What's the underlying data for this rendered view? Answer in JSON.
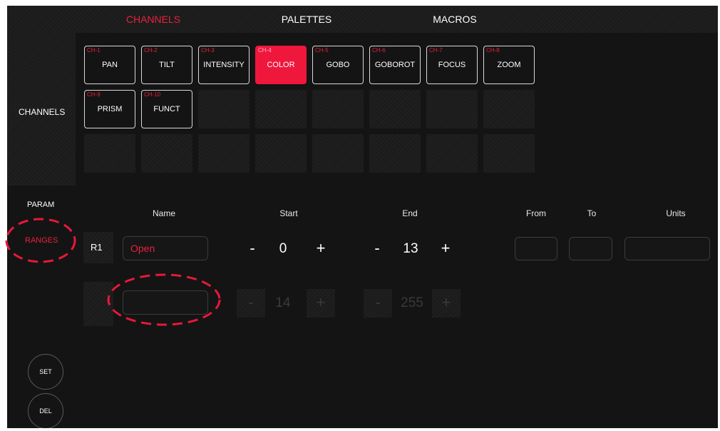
{
  "tabs": {
    "channels": "CHANNELS",
    "palettes": "PALETTES",
    "macros": "MACROS"
  },
  "colors": {
    "accent": "#e8203e",
    "selected_channel": "#f0173d",
    "annotation": "#e8183a"
  },
  "sidebar": {
    "channels": "CHANNELS",
    "param": "PARAM",
    "ranges": "RANGES"
  },
  "channels": [
    {
      "num": "CH-1",
      "name": "PAN"
    },
    {
      "num": "CH-2",
      "name": "TILT"
    },
    {
      "num": "CH-3",
      "name": "INTENSITY"
    },
    {
      "num": "CH-4",
      "name": "COLOR",
      "selected": true
    },
    {
      "num": "CH-5",
      "name": "GOBO"
    },
    {
      "num": "CH-6",
      "name": "GOBOROT"
    },
    {
      "num": "CH-7",
      "name": "FOCUS"
    },
    {
      "num": "CH-8",
      "name": "ZOOM"
    },
    {
      "num": "CH-9",
      "name": "PRISM"
    },
    {
      "num": "CH-10",
      "name": "FUNCT"
    }
  ],
  "headers": {
    "name": "Name",
    "start": "Start",
    "end": "End",
    "from": "From",
    "to": "To",
    "units": "Units"
  },
  "ranges": [
    {
      "label": "R1",
      "name": "Open",
      "start": "0",
      "end": "13"
    },
    {
      "label": "",
      "name": "",
      "start": "14",
      "end": "255"
    }
  ],
  "steppers": {
    "minus": "-",
    "plus": "+"
  },
  "actions": {
    "set": "SET",
    "del": "DEL"
  }
}
